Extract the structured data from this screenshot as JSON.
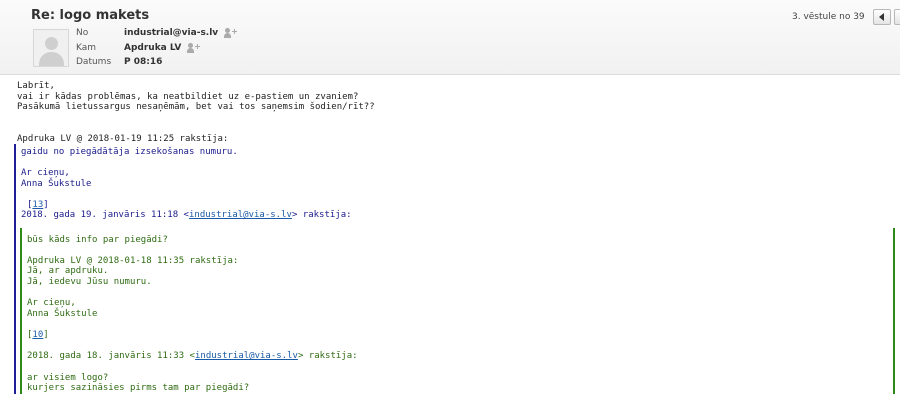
{
  "header": {
    "subject": "Re: logo makets",
    "counter": "3. vēstule no 39",
    "from_label": "No",
    "from_value": "industrial@via-s.lv",
    "to_label": "Kam",
    "to_value": "Apdruka LV",
    "date_label": "Datums",
    "date_value": "P 08:16"
  },
  "body": {
    "l1": "Labrīt,",
    "l2": "vai ir kādas problēmas, ka neatbildiet uz e-pastiem un zvaniem?",
    "l3": "Pasākumā lietussargus nesaņēmām, bet vai tos saņemsim šodien/rīt??",
    "q1_header": "Apdruka LV @ 2018-01-19 11:25 rakstīja:",
    "q1_l1": "gaidu no piegādātāja izsekošanas numuru.",
    "q1_l2": "Ar cieņu,",
    "q1_l3": "Anna Šukstule",
    "q1_ref_open": "[",
    "q1_ref": "13",
    "q1_ref_close": "]",
    "q1_cite_pre": "2018. gada 19. janvāris 11:18 <",
    "q1_cite_link": "industrial@via-s.lv",
    "q1_cite_post": "> rakstīja:",
    "q2_l1": "būs kāds info par piegādi?",
    "q2_l2": "Apdruka LV @ 2018-01-18 11:35 rakstīja:",
    "q2_l3": "Jā, ar apdruku.",
    "q2_l4": "Jā, iedevu Jūsu numuru.",
    "q2_l5": "Ar cieņu,",
    "q2_l6": "Anna Šukstule",
    "q2_ref_open": "[",
    "q2_ref": "10",
    "q2_ref_close": "]",
    "q2_cite_pre": "2018. gada 18. janvāris 11:33 <",
    "q2_cite_link": "industrial@via-s.lv",
    "q2_cite_post": "> rakstīja:",
    "q2_l7": "ar visiem logo?",
    "q2_l8": "kurjers sazināsies pirms tam par piegādi?"
  },
  "colors": {
    "quote_level1": "#1f1f9a",
    "quote_level2": "#2e8a16",
    "link": "#1a5aa6"
  },
  "icons": {
    "add_contact": "add-contact-icon",
    "avatar": "user-avatar-icon",
    "prev": "chevron-left-icon",
    "next": "chevron-right-icon"
  }
}
